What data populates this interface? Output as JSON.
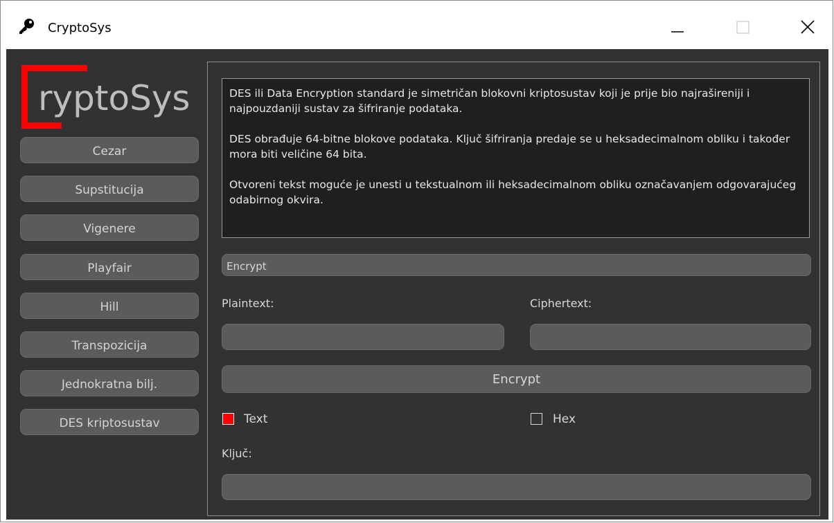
{
  "window": {
    "title": "CryptoSys",
    "app_icon": "key-icon",
    "controls": [
      "minimize-icon",
      "maximize-icon",
      "close-icon"
    ]
  },
  "logo": {
    "text": "ryptoSys",
    "bracket_color": "#ff0000"
  },
  "sidebar": {
    "items": [
      {
        "label": "Cezar"
      },
      {
        "label": "Supstitucija"
      },
      {
        "label": "Vigenere"
      },
      {
        "label": "Playfair"
      },
      {
        "label": "Hill"
      },
      {
        "label": "Transpozicija"
      },
      {
        "label": "Jednokratna bilj."
      },
      {
        "label": "DES kriptosustav"
      }
    ]
  },
  "description": {
    "paragraphs": [
      "DES ili Data Encryption standard je simetričan blokovni kriptosustav koji je prije bio najrašireniji i najpouzdaniji sustav za šifriranje podataka.",
      "DES obrađuje 64-bitne blokove podataka. Ključ šifriranja predaje se u heksadecimalnom obliku i također mora biti veličine 64 bita.",
      "Otvoreni tekst moguće je unesti u tekstualnom ili heksadecimalnom obliku označavanjem odgovarajućeg odabirnog okvira."
    ]
  },
  "form": {
    "mode_selected": "Encrypt",
    "plaintext_label": "Plaintext:",
    "plaintext_value": "",
    "ciphertext_label": "Ciphertext:",
    "ciphertext_value": "",
    "encrypt_button": "Encrypt",
    "text_checkbox": {
      "label": "Text",
      "checked": true
    },
    "hex_checkbox": {
      "label": "Hex",
      "checked": false
    },
    "key_label": "Ključ:",
    "key_value": ""
  },
  "colors": {
    "background": "#323232",
    "accent": "#ff0000",
    "button": "#5b5b5b",
    "text": "#d8d8d8"
  }
}
